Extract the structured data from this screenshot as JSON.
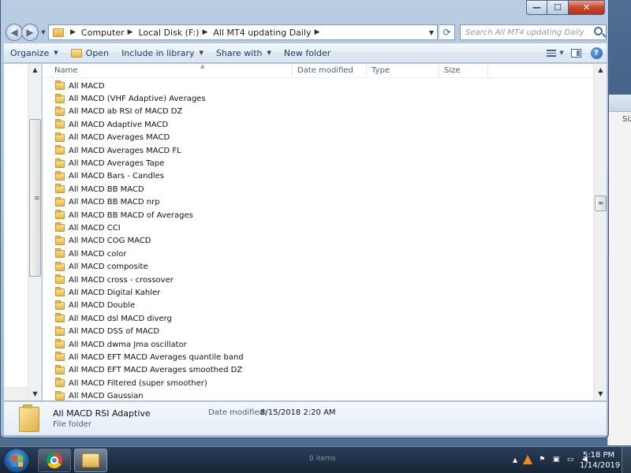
{
  "window": {
    "caption_buttons": {
      "minimize": "—",
      "maximize": "☐",
      "close": "✕"
    }
  },
  "address_bar": {
    "crumbs": [
      "Computer",
      "Local Disk (F:)",
      "All MT4 updating Daily"
    ]
  },
  "search": {
    "placeholder": "Search All MT4 updating Daily"
  },
  "command_bar": {
    "organize": "Organize",
    "open": "Open",
    "include_in_library": "Include in library",
    "share_with": "Share with",
    "new_folder": "New folder"
  },
  "columns": {
    "name": "Name",
    "date_modified": "Date modified",
    "type": "Type",
    "size": "Size"
  },
  "files": [
    "All  MACD",
    "All  MACD (VHF Adaptive) Averages",
    "All  MACD ab RSI of MACD DZ",
    "All  MACD Adaptive MACD",
    "All  MACD Averages MACD",
    "All  MACD Averages MACD FL",
    "All  MACD Averages Tape",
    "All  MACD Bars - Candles",
    "All  MACD BB MACD",
    "All  MACD BB MACD nrp",
    "All  MACD BB MACD of Averages",
    "All  MACD CCI",
    "All  MACD COG MACD",
    "All  MACD color",
    "All  MACD composite",
    "All  MACD cross - crossover",
    "All  MACD Digital Kahler",
    "All  MACD Double",
    "All  MACD dsl MACD diverg",
    "All  MACD DSS of MACD",
    "All  MACD dwma Jma oscillator",
    "All  MACD EFT MACD Averages quantile band",
    "All  MACD EFT MACD Averages smoothed DZ",
    "All  MACD Filtered (super smoother)",
    "All  MACD Gaussian"
  ],
  "details": {
    "name": "All  MACD RSI Adaptive",
    "date_label": "Date modified:",
    "date_value": "8/15/2018 2:20 AM",
    "type": "File folder"
  },
  "background_window": {
    "size_label": "Siz"
  },
  "taskbar": {
    "time": "5:18 PM",
    "date": "1/14/2019",
    "ghost_label": "0 items"
  }
}
